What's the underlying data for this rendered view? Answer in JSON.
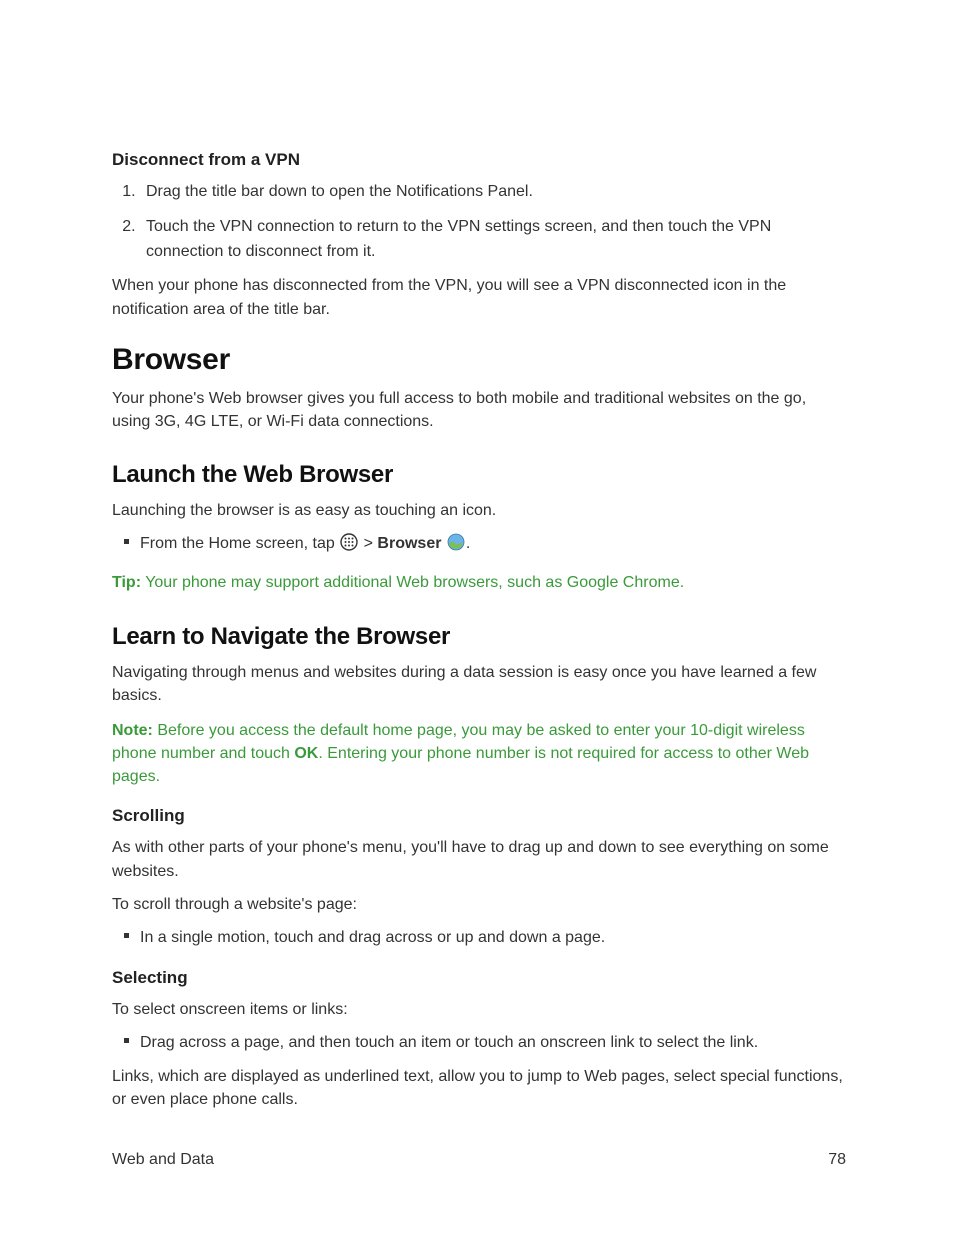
{
  "section_disconnect": {
    "heading": "Disconnect from a VPN",
    "steps": [
      "Drag the title bar down to open the Notifications Panel.",
      "Touch the VPN connection to return to the VPN settings screen, and then touch the VPN connection to disconnect from it."
    ],
    "after": "When your phone has disconnected from the VPN, you will see a VPN disconnected icon in the notification area of the title bar."
  },
  "section_browser": {
    "title": "Browser",
    "intro": "Your phone's Web browser gives you full access to both mobile and traditional websites on the go, using 3G, 4G LTE, or Wi-Fi data connections."
  },
  "section_launch": {
    "title": "Launch the Web Browser",
    "intro": "Launching the browser is as easy as touching an icon.",
    "bullet_prefix": "From the Home screen, tap ",
    "bullet_gt": " > ",
    "bullet_bold": "Browser",
    "bullet_suffix": " .",
    "tip_label": "Tip:",
    "tip_text": " Your phone may support additional Web browsers, such as Google Chrome."
  },
  "section_navigate": {
    "title": "Learn to Navigate the Browser",
    "intro": "Navigating through menus and websites during a data session is easy once you have learned a few basics.",
    "note_label": "Note:",
    "note_pre": " Before you access the default home page, you may be asked to enter your 10-digit wireless phone number and touch ",
    "note_bold": "OK",
    "note_post": ". Entering your phone number is not required for access to other Web pages."
  },
  "section_scrolling": {
    "heading": "Scrolling",
    "p1": "As with other parts of your phone's menu, you'll have to drag up and down to see everything on some websites.",
    "p2": "To scroll through a website's page:",
    "bullet": "In a single motion, touch and drag across or up and down a page."
  },
  "section_selecting": {
    "heading": "Selecting",
    "intro": "To select onscreen items or links:",
    "bullet": "Drag across a page, and then touch an item or touch an onscreen link to select the link.",
    "after": "Links, which are displayed as underlined text, allow you to jump to Web pages, select special functions, or even place phone calls."
  },
  "footer": {
    "left": "Web and Data",
    "right": "78"
  }
}
